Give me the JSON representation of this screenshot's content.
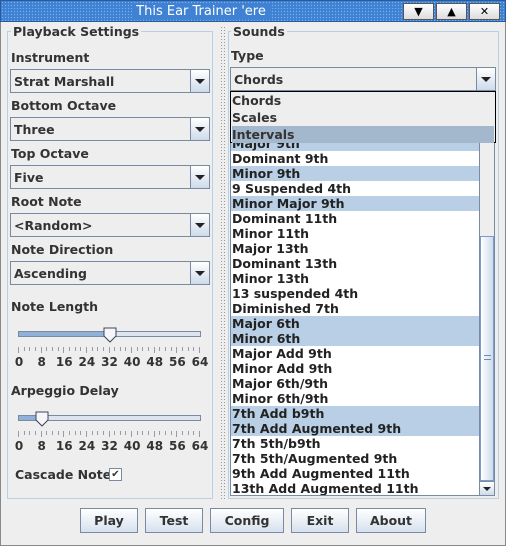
{
  "window": {
    "title": "This Ear Trainer 'ere",
    "buttons": {
      "minimize": "▼",
      "maximize": "▲",
      "close": "✕"
    }
  },
  "playback": {
    "title": "Playback Settings",
    "instrument": {
      "label": "Instrument",
      "value": "Strat Marshall"
    },
    "bottom_octave": {
      "label": "Bottom Octave",
      "value": "Three"
    },
    "top_octave": {
      "label": "Top Octave",
      "value": "Five"
    },
    "root_note": {
      "label": "Root Note",
      "value": "<Random>"
    },
    "note_direction": {
      "label": "Note Direction",
      "value": "Ascending"
    },
    "note_length": {
      "label": "Note Length",
      "value": 32,
      "min": 0,
      "max": 64
    },
    "arpeggio_delay": {
      "label": "Arpeggio Delay",
      "value": 8,
      "min": 0,
      "max": 64
    },
    "slider_ticks": [
      "0",
      "8",
      "16",
      "24",
      "32",
      "40",
      "48",
      "56",
      "64"
    ],
    "cascade": {
      "label": "Cascade Notes",
      "checked": true
    }
  },
  "sounds": {
    "title": "Sounds",
    "type": {
      "label": "Type",
      "value": "Chords",
      "options": [
        "Chords",
        "Scales",
        "Intervals"
      ],
      "highlighted": "Intervals"
    },
    "items": [
      {
        "label": "Major 9th",
        "selected": true
      },
      {
        "label": "Dominant 9th",
        "selected": false
      },
      {
        "label": "Minor 9th",
        "selected": true
      },
      {
        "label": "9 Suspended 4th",
        "selected": false
      },
      {
        "label": "Minor Major 9th",
        "selected": true
      },
      {
        "label": "Dominant 11th",
        "selected": false
      },
      {
        "label": "Minor 11th",
        "selected": false
      },
      {
        "label": "Major 13th",
        "selected": false
      },
      {
        "label": "Dominant 13th",
        "selected": false
      },
      {
        "label": "Minor 13th",
        "selected": false
      },
      {
        "label": "13 suspended 4th",
        "selected": false
      },
      {
        "label": "Diminished 7th",
        "selected": false
      },
      {
        "label": "Major 6th",
        "selected": true
      },
      {
        "label": "Minor 6th",
        "selected": true
      },
      {
        "label": "Major Add 9th",
        "selected": false
      },
      {
        "label": "Minor Add 9th",
        "selected": false
      },
      {
        "label": "Major 6th/9th",
        "selected": false
      },
      {
        "label": "Minor 6th/9th",
        "selected": false
      },
      {
        "label": "7th Add b9th",
        "selected": true
      },
      {
        "label": "7th Add Augmented 9th",
        "selected": true
      },
      {
        "label": "7th 5th/b9th",
        "selected": false
      },
      {
        "label": "7th 5th/Augmented 9th",
        "selected": false
      },
      {
        "label": "9th Add Augmented 11th",
        "selected": false
      },
      {
        "label": "13th Add Augmented 11th",
        "selected": false
      }
    ]
  },
  "buttons": [
    "Play",
    "Test",
    "Config",
    "Exit",
    "About"
  ],
  "colors": {
    "titlebar": "#3f82d4",
    "selection": "#b8cfe5",
    "popup_highlight": "#a3b8cc"
  }
}
